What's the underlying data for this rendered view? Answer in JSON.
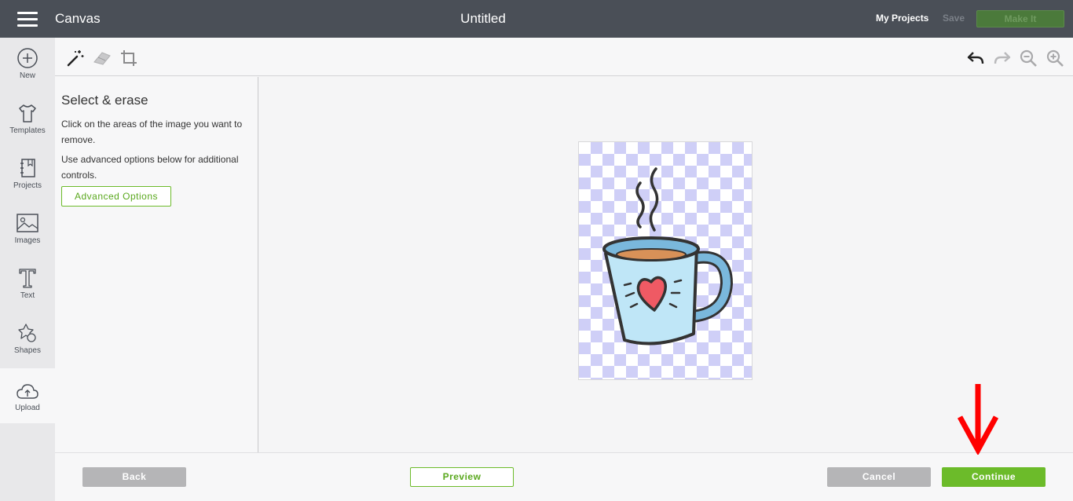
{
  "header": {
    "app_name": "Canvas",
    "doc_title": "Untitled",
    "my_projects": "My Projects",
    "save": "Save",
    "make_it": "Make It"
  },
  "leftnav": {
    "items": [
      {
        "label": "New",
        "icon": "plus-circle-icon"
      },
      {
        "label": "Templates",
        "icon": "tshirt-icon"
      },
      {
        "label": "Projects",
        "icon": "notebook-icon"
      },
      {
        "label": "Images",
        "icon": "image-icon"
      },
      {
        "label": "Text",
        "icon": "text-t-icon"
      },
      {
        "label": "Shapes",
        "icon": "shapes-icon"
      },
      {
        "label": "Upload",
        "icon": "cloud-upload-icon"
      }
    ],
    "active": "Upload"
  },
  "toolbar": {
    "left_tools": [
      "magic-wand-icon",
      "eraser-icon",
      "crop-icon"
    ],
    "right_tools": [
      "undo-icon",
      "redo-icon",
      "zoom-out-icon",
      "zoom-in-icon"
    ]
  },
  "panel": {
    "title": "Select & erase",
    "p1": "Click on the areas of the image you want to remove.",
    "p2": "Use advanced options below for additional controls.",
    "advanced_button": "Advanced Options"
  },
  "canvas": {
    "image": "coffee-mug-with-heart-illustration"
  },
  "bottombar": {
    "back": "Back",
    "preview": "Preview",
    "cancel": "Cancel",
    "continue": "Continue"
  },
  "colors": {
    "header_bg": "#4a4f57",
    "accent_green": "#6cbb2a",
    "annotation_arrow": "#ff0000"
  }
}
